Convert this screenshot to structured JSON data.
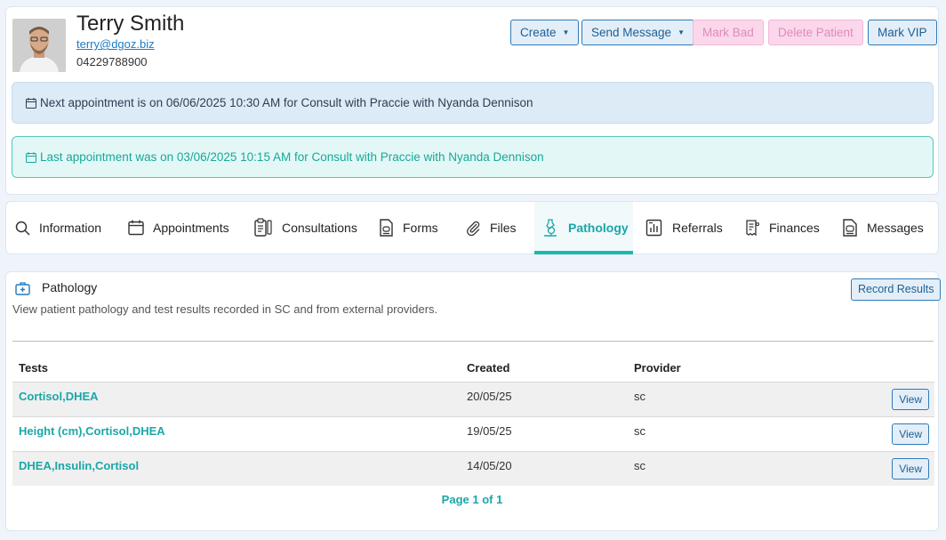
{
  "patient": {
    "name": "Terry Smith",
    "email": "terry@dgoz.biz",
    "phone": "04229788900"
  },
  "actions": {
    "create": "Create",
    "send_message": "Send Message",
    "mark_bad": "Mark Bad",
    "delete_patient": "Delete Patient",
    "mark_vip": "Mark VIP"
  },
  "appointments": {
    "next": "Next appointment is on 06/06/2025 10:30 AM for Consult with Praccie with Nyanda Dennison",
    "last": "Last appointment was on 03/06/2025 10:15 AM for Consult with Praccie with Nyanda Dennison"
  },
  "tabs": [
    {
      "label": "Information",
      "icon": "search-icon"
    },
    {
      "label": "Appointments",
      "icon": "calendar-icon"
    },
    {
      "label": "Consultations",
      "icon": "clipboard-icon"
    },
    {
      "label": "Forms",
      "icon": "form-icon"
    },
    {
      "label": "Files",
      "icon": "paperclip-icon"
    },
    {
      "label": "Pathology",
      "icon": "microscope-icon",
      "active": true
    },
    {
      "label": "Referrals",
      "icon": "referral-icon"
    },
    {
      "label": "Finances",
      "icon": "receipt-icon"
    },
    {
      "label": "Messages",
      "icon": "message-icon"
    }
  ],
  "pathology": {
    "title": "Pathology",
    "description": "View patient pathology and test results recorded in SC and from external providers.",
    "record_results": "Record Results",
    "columns": [
      "Tests",
      "Created",
      "Provider"
    ],
    "rows": [
      {
        "tests": "Cortisol,DHEA",
        "created": "20/05/25",
        "provider": "sc",
        "action": "View"
      },
      {
        "tests": "Height (cm),Cortisol,DHEA",
        "created": "19/05/25",
        "provider": "sc",
        "action": "View"
      },
      {
        "tests": "DHEA,Insulin,Cortisol",
        "created": "14/05/20",
        "provider": "sc",
        "action": "View"
      }
    ],
    "pagination": "Page 1 of 1"
  },
  "colors": {
    "accent": "#1aa7a8",
    "primary_button": "#2f7ab8",
    "danger_button": "#fbd7ec"
  }
}
